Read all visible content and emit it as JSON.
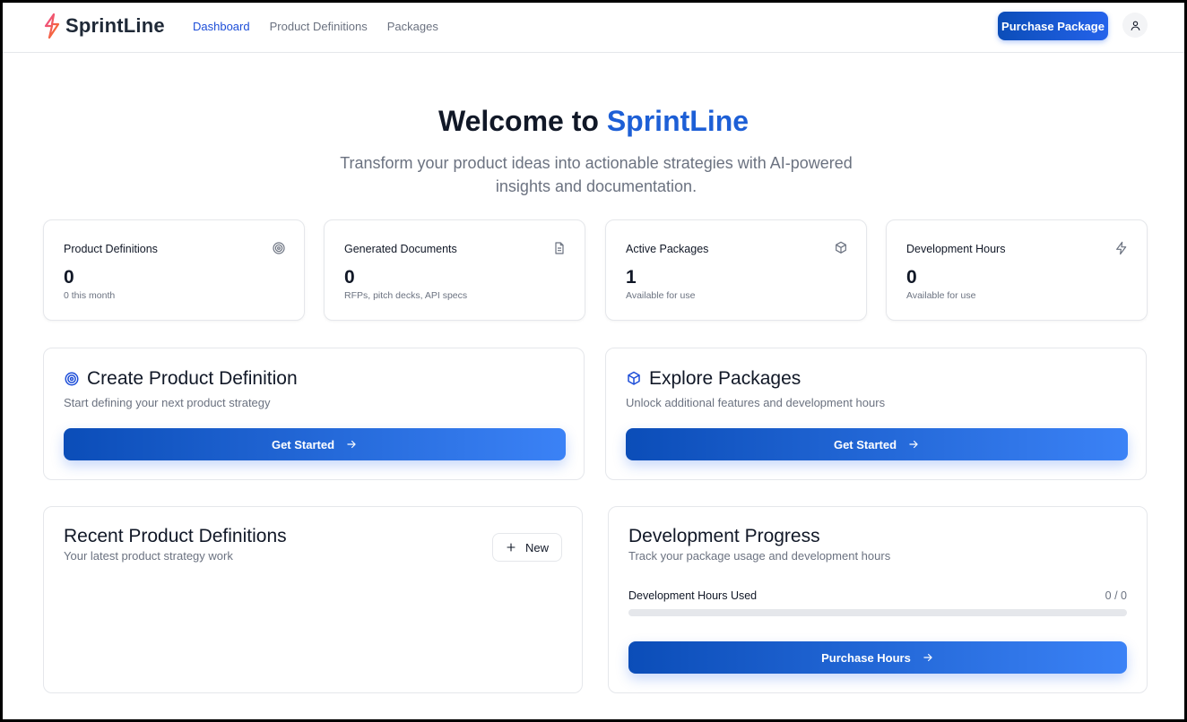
{
  "brand": {
    "name": "SprintLine",
    "accent": "#1d5fd6"
  },
  "nav": {
    "items": [
      {
        "label": "Dashboard",
        "active": true
      },
      {
        "label": "Product Definitions",
        "active": false
      },
      {
        "label": "Packages",
        "active": false
      }
    ],
    "purchase_label": "Purchase Package",
    "user_icon": "user-icon"
  },
  "hero": {
    "title_prefix": "Welcome to",
    "title_brand": "SprintLine",
    "subtitle": "Transform your product ideas into actionable strategies with AI-powered insights and documentation."
  },
  "stats": [
    {
      "title": "Product Definitions",
      "value": "0",
      "note": "0 this month",
      "icon": "target-icon"
    },
    {
      "title": "Generated Documents",
      "value": "0",
      "note": "RFPs, pitch decks, API specs",
      "icon": "document-icon"
    },
    {
      "title": "Active Packages",
      "value": "1",
      "note": "Available for use",
      "icon": "package-icon"
    },
    {
      "title": "Development Hours",
      "value": "0",
      "note": "Available for use",
      "icon": "bolt-icon"
    }
  ],
  "actions": [
    {
      "title": "Create Product Definition",
      "subtitle": "Start defining your next product strategy",
      "button": "Get Started",
      "icon": "target-icon"
    },
    {
      "title": "Explore Packages",
      "subtitle": "Unlock additional features and development hours",
      "button": "Get Started",
      "icon": "package-icon"
    }
  ],
  "recent": {
    "title": "Recent Product Definitions",
    "subtitle": "Your latest product strategy work",
    "new_label": "New"
  },
  "progress": {
    "title": "Development Progress",
    "subtitle": "Track your package usage and development hours",
    "label": "Development Hours Used",
    "value_text": "0 / 0",
    "fraction": 0,
    "button": "Purchase Hours"
  }
}
